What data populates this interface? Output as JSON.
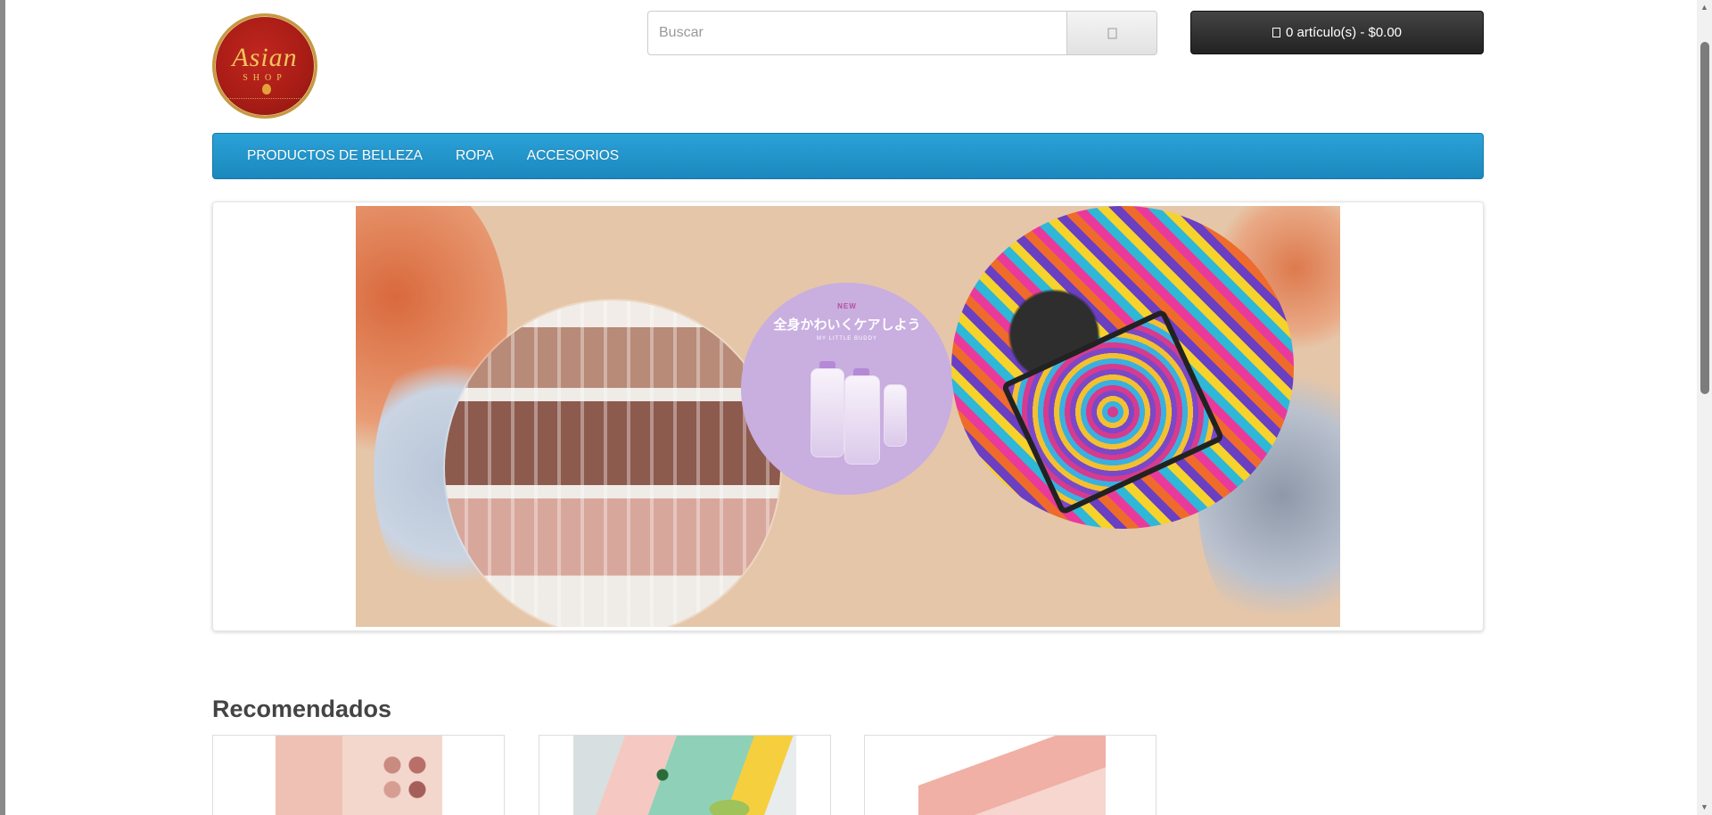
{
  "logo": {
    "text_line1": "Asian",
    "text_line2": "SHOP",
    "brand_color": "#a91d16"
  },
  "search": {
    "placeholder": "Buscar",
    "button_icon": "search-icon"
  },
  "cart": {
    "icon": "shopping-cart-icon",
    "label": "0 artículo(s) - $0.00"
  },
  "menu": {
    "items": [
      {
        "label": "PRODUCTOS DE BELLEZA"
      },
      {
        "label": "ROPA"
      },
      {
        "label": "ACCESORIOS"
      }
    ],
    "color": "#1f94cc"
  },
  "slideshow": {
    "banner": {
      "new_label": "NEW",
      "japanese_text": "全身かわいくケアしよう",
      "brand_label": "MY LITTLE BUDDY"
    }
  },
  "recommended": {
    "title": "Recomendados",
    "products": [
      {
        "image": "eyeshadow-palette-image"
      },
      {
        "image": "face-masks-image"
      },
      {
        "image": "lip-tint-image"
      }
    ]
  }
}
